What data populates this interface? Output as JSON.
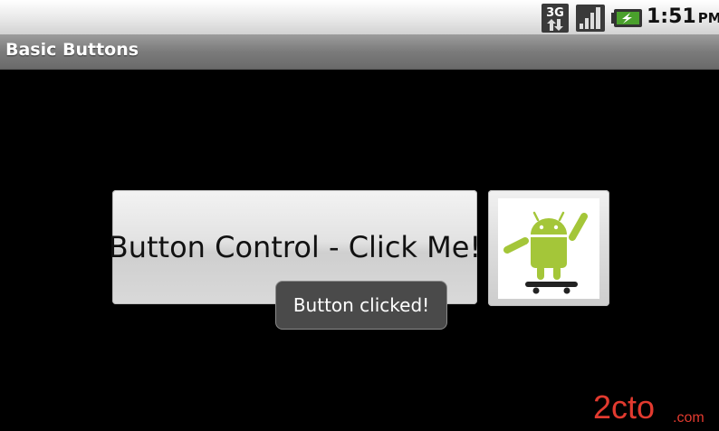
{
  "status_bar": {
    "network_type": "3G",
    "network_icon": "3g-data-icon",
    "signal_icon": "signal-strength-icon",
    "battery_icon": "battery-charging-icon",
    "time": "1:51",
    "ampm": "PM"
  },
  "title_bar": {
    "title": "Basic Buttons"
  },
  "main": {
    "button_label": "Button Control - Click Me!",
    "image_button_icon": "android-skateboard-icon"
  },
  "toast": {
    "message": "Button clicked!"
  },
  "watermark": {
    "text": "2cto",
    "suffix": ".com"
  },
  "colors": {
    "android_green": "#a4c639",
    "toast_bg": "#4a4a4a",
    "watermark_red": "#e23a2f"
  }
}
